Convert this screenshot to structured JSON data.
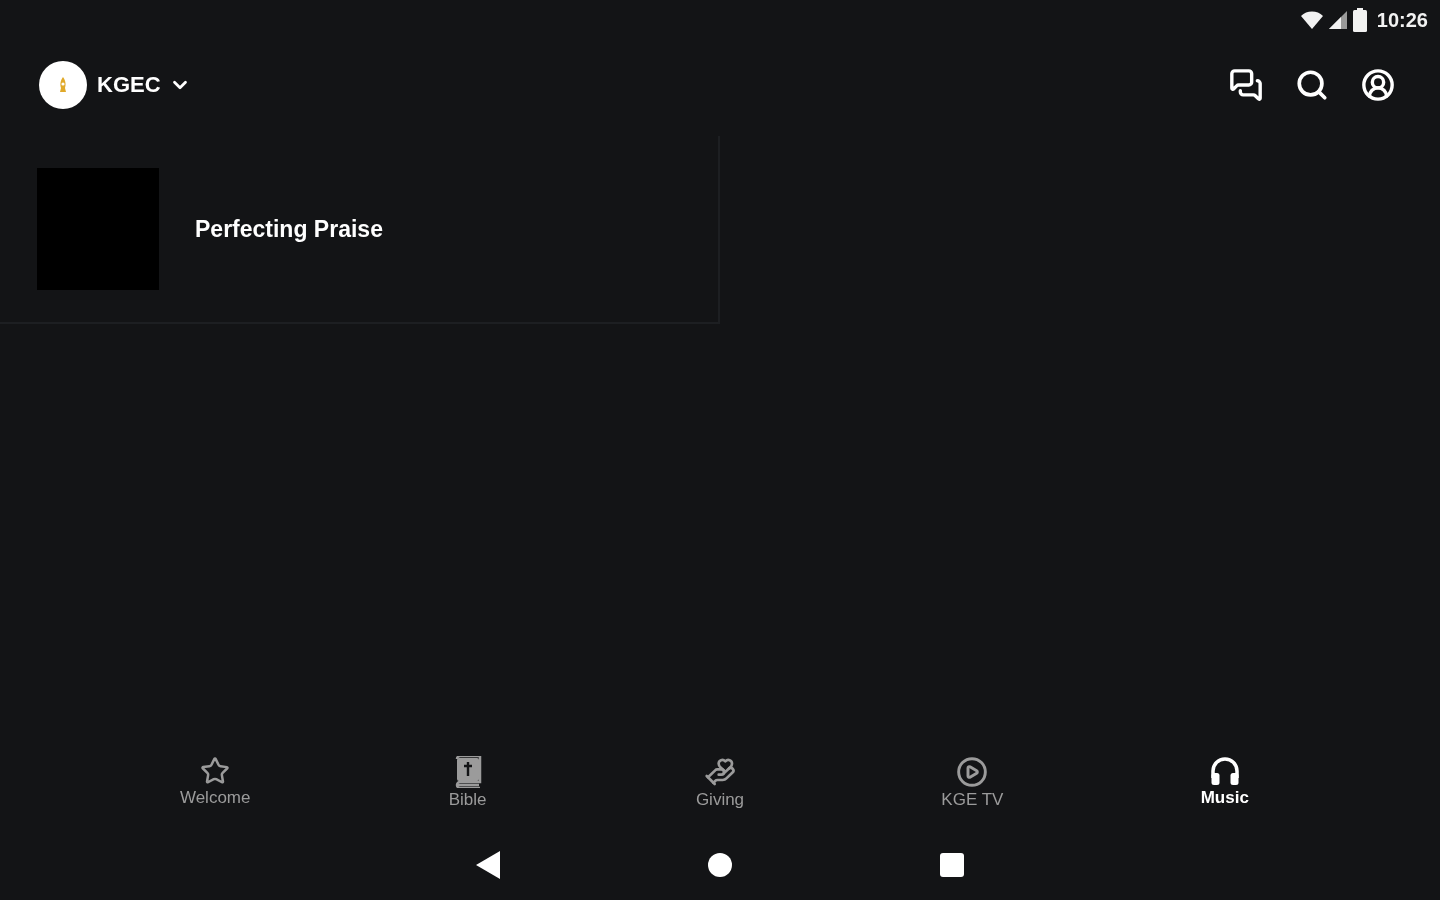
{
  "status_bar": {
    "time": "10:26"
  },
  "header": {
    "title": "KGEC"
  },
  "items": [
    {
      "title": "Perfecting Praise"
    }
  ],
  "bottom_nav": [
    {
      "label": "Welcome",
      "kind": "star",
      "selected": false
    },
    {
      "label": "Bible",
      "kind": "bible",
      "selected": false
    },
    {
      "label": "Giving",
      "kind": "giving",
      "selected": false
    },
    {
      "label": "KGE TV",
      "kind": "play",
      "selected": false
    },
    {
      "label": "Music",
      "kind": "headphones",
      "selected": true
    }
  ]
}
